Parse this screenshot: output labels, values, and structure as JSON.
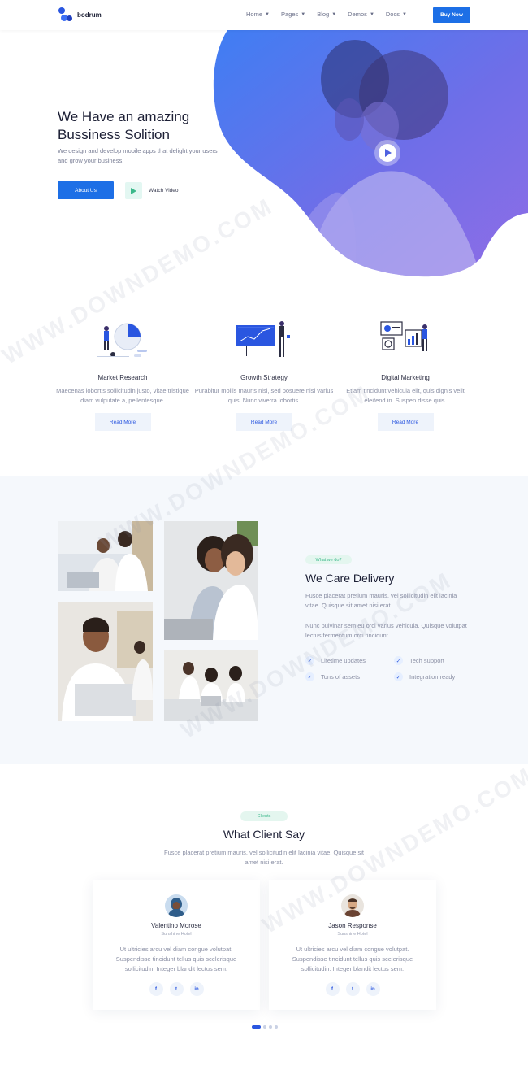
{
  "brand": {
    "name": "bodrum"
  },
  "nav": {
    "items": [
      {
        "label": "Home"
      },
      {
        "label": "Pages"
      },
      {
        "label": "Blog"
      },
      {
        "label": "Demos"
      },
      {
        "label": "Docs"
      }
    ],
    "cta_label": "Buy Now"
  },
  "hero": {
    "title_line1": "We Have an amazing",
    "title_line2": "Bussiness Solition",
    "subtitle": "We design and develop mobile apps that delight your users and grow your business.",
    "primary_button": "About Us",
    "video_label": "Watch Video"
  },
  "services": [
    {
      "title": "Market Research",
      "text": "Maecenas lobortis sollicitudin justo, vitae tristique diam vulputate a, pellentesque.",
      "button": "Read More"
    },
    {
      "title": "Growth Strategy",
      "text": "Purabitur mollis mauris nisi, sed posuere nisi varius quis. Nunc viverra lobortis.",
      "button": "Read More"
    },
    {
      "title": "Digital Marketing",
      "text": "Etiam tincidunt vehicula elit, quis dignis velit eleifend in. Suspen disse quis.",
      "button": "Read More"
    }
  ],
  "delivery": {
    "tag": "What we do?",
    "title": "We Care Delivery",
    "paragraph1": "Fusce placerat pretium mauris, vel sollicitudin elit lacinia vitae. Quisque sit amet nisi erat.",
    "paragraph2": "Nunc pulvinar sem eu orci varius vehicula. Quisque volutpat lectus fermentum orci tincidunt.",
    "features": [
      "Lifetime updates",
      "Tech support",
      "Tons of assets",
      "Integration ready"
    ]
  },
  "clients": {
    "tag": "Clients",
    "title": "What Client Say",
    "subtitle": "Fusce placerat pretium mauris, vel sollicitudin elit lacinia vitae. Quisque sit amet nisi erat.",
    "cards": [
      {
        "name": "Valentino Morose",
        "org": "Sunshine Hotel",
        "quote": "Ut ultricies arcu vel diam congue volutpat. Suspendisse tincidunt tellus quis scelerisque sollicitudin. Integer blandit lectus sem."
      },
      {
        "name": "Jason Response",
        "org": "Sunshine Hotel",
        "quote": "Ut ultricies arcu vel diam congue volutpat. Suspendisse tincidunt tellus quis scelerisque sollicitudin. Integer blandit lectus sem."
      }
    ],
    "social_icons": [
      "f",
      "t",
      "in"
    ]
  },
  "watermark": "WWW.DOWNDEMO.COM",
  "colors": {
    "primary": "#1d6fe6",
    "accent_green": "#3bb88a",
    "section_bg": "#f5f8fc"
  }
}
